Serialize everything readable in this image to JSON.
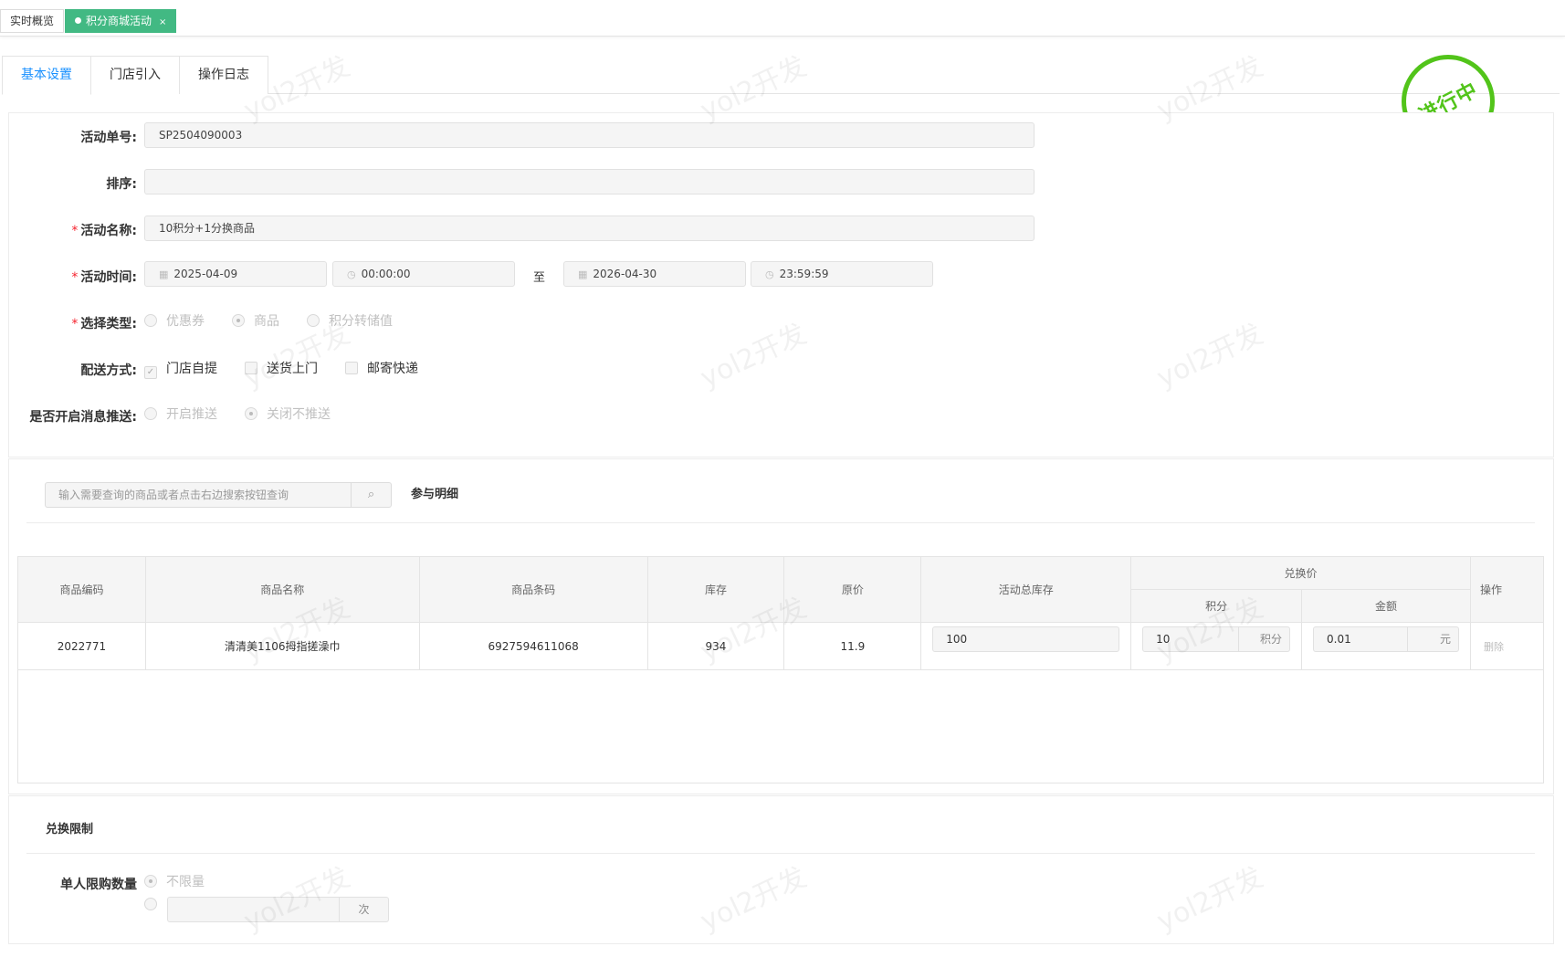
{
  "top_tabs": [
    {
      "label": "实时概览"
    },
    {
      "label": "积分商城活动",
      "close": "×"
    }
  ],
  "sub_tabs": [
    {
      "label": "基本设置"
    },
    {
      "label": "门店引入"
    },
    {
      "label": "操作日志"
    }
  ],
  "status_stamp": "进行中",
  "form": {
    "activity_no": {
      "label": "活动单号:",
      "value": "SP2504090003"
    },
    "sort": {
      "label": "排序:",
      "value": ""
    },
    "activity_name": {
      "label": "活动名称:",
      "value": "10积分+1分换商品"
    },
    "activity_time": {
      "label": "活动时间:",
      "start_date": "2025-04-09",
      "start_time": "00:00:00",
      "sep": "至",
      "end_date": "2026-04-30",
      "end_time": "23:59:59"
    },
    "select_type": {
      "label": "选择类型:",
      "options": [
        "优惠券",
        "商品",
        "积分转储值"
      ],
      "selected": "商品"
    },
    "delivery": {
      "label": "配送方式:",
      "options": [
        "门店自提",
        "送货上门",
        "邮寄快递"
      ],
      "checked": [
        "门店自提"
      ]
    },
    "push": {
      "label": "是否开启消息推送:",
      "options": [
        "开启推送",
        "关闭不推送"
      ],
      "selected": "关闭不推送"
    }
  },
  "detail": {
    "search_placeholder": "输入需要查询的商品或者点击右边搜索按钮查询",
    "title": "参与明细",
    "columns": {
      "code": "商品编码",
      "name": "商品名称",
      "barcode": "商品条码",
      "stock": "库存",
      "price": "原价",
      "act_stock": "活动总库存",
      "exchange": "兑换价",
      "points": "积分",
      "amount": "金额",
      "op": "操作"
    },
    "rows": [
      {
        "code": "2022771",
        "name": "清清美1106拇指搓澡巾",
        "barcode": "6927594611068",
        "stock": "934",
        "price": "11.9",
        "act_stock": "100",
        "points": "10",
        "points_unit": "积分",
        "amount": "0.01",
        "amount_unit": "元",
        "op": "删除"
      }
    ]
  },
  "limit": {
    "title": "兑换限制",
    "label": "单人限购数量",
    "unlimited": "不限量",
    "unit": "次"
  },
  "watermark": "yol2开发",
  "colors": {
    "accent": "#42b983",
    "link": "#1890ff",
    "stamp": "#52c41a",
    "required": "#f5222d"
  }
}
